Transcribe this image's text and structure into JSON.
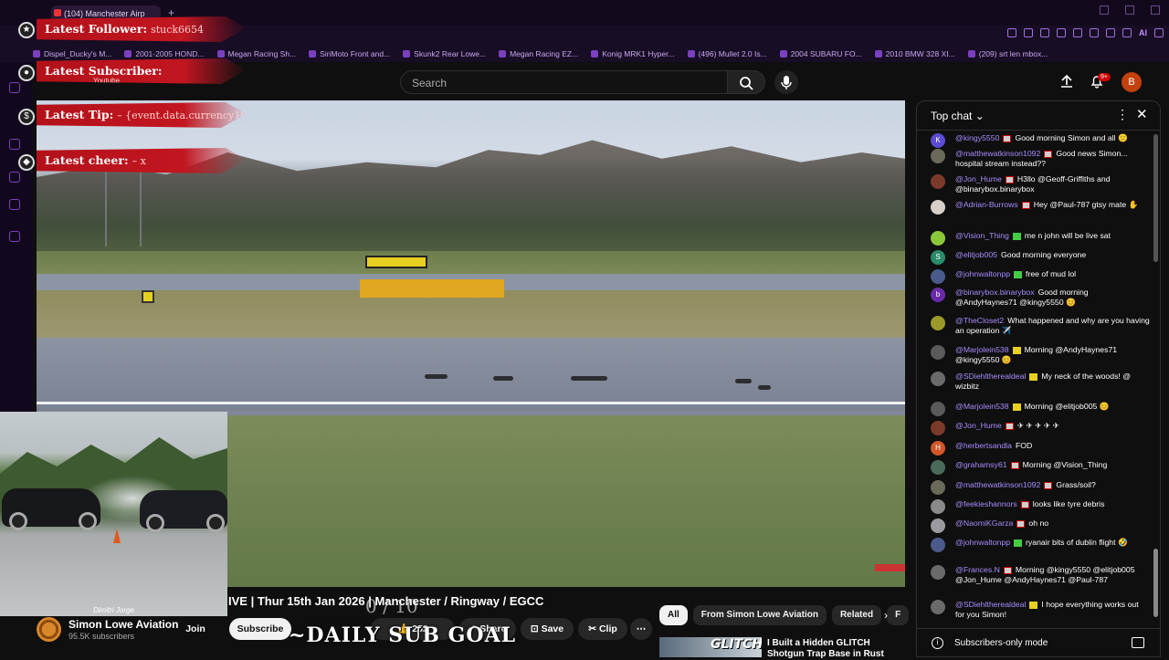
{
  "browser": {
    "tab_title": "(104) Manchester Airp",
    "new_tab": "+",
    "ai_label": "AI",
    "bookmarks": [
      "Dispel_Ducky's M...",
      "2001-2005 HOND...",
      "Megan Racing Sh...",
      "SiriMoto Front and...",
      "Skunk2 Rear Lowe...",
      "Megan Racing EZ...",
      "Konig MRK1 Hyper...",
      "(496) Mullet 2.0 Is...",
      "2004 SUBARU FO...",
      "2010 BMW 328 XI...",
      "(209) srt len mbox..."
    ]
  },
  "youtube": {
    "search_placeholder": "Search",
    "notification_count": "9+",
    "avatar_letter": "B"
  },
  "overlay": {
    "latest_follower_label": "Latest Follower:",
    "latest_follower_value": "stuck6654",
    "latest_subscriber_label": "Latest Subscriber:",
    "latest_subscriber_value": "Youtube",
    "latest_tip_label": "Latest Tip:",
    "latest_tip_value": "– {event.data.currency}0",
    "latest_cheer_label": "Latest cheer:",
    "latest_cheer_value": "– x",
    "daily_goal": "~DAILY SUB GOAL",
    "goal_count": "0 / 10",
    "webcam_caption": "Dimitri Jorge"
  },
  "video": {
    "title": "IVE | Thur 15th Jan 2026 | Manchester / Ringway / EGCC",
    "channel_name": "Simon Lowe Aviation",
    "channel_subs": "95.5K subscribers",
    "join": "Join",
    "subscribe": "Subscribe",
    "likes": "252",
    "share": "Share",
    "save": "Save",
    "clip": "Clip",
    "more": "⋯"
  },
  "related": {
    "chips": [
      "All",
      "From Simon Lowe Aviation",
      "Related",
      "F"
    ],
    "thumb_text": "GLITCH",
    "rec_title": "I Built a Hidden GLITCH Shotgun Trap Base in Rust"
  },
  "chat": {
    "title": "Top chat",
    "footer": "Subscribers-only mode",
    "messages": [
      {
        "author": "@kingy5550",
        "text": "Good morning Simon and all 🙂",
        "avatar": "K",
        "color": "#5a4bd1",
        "badge": "r"
      },
      {
        "author": "@matthewatkinson1092",
        "text": "Good news Simon... hospital stream instead??",
        "avatar": "",
        "color": "#6b6a5a",
        "badge": "r"
      },
      {
        "author": "@Jon_Hume",
        "text": "H3llo @Geoff-Griffiths and @binarybox.binarybox",
        "avatar": "",
        "color": "#7a3a2a",
        "badge": "r"
      },
      {
        "author": "@Adrian-Burrows",
        "text": "Hey @Paul-787 gtsy mate ✋",
        "avatar": "",
        "color": "#d8d0c8",
        "badge": "r"
      },
      {
        "author": "@Vision_Thing",
        "text": "me n john will be live sat",
        "avatar": "",
        "color": "#8ac83a",
        "badge": "g"
      },
      {
        "author": "@elitjob005",
        "text": "Good morning everyone",
        "avatar": "S",
        "color": "#2a8a6a",
        "badge": ""
      },
      {
        "author": "@johnwaltonpp",
        "text": "free of mud lol",
        "avatar": "",
        "color": "#4a5a8a",
        "badge": "g"
      },
      {
        "author": "@binarybox.binarybox",
        "text": "Good morning @AndyHaynes71 @kingy5550 😊",
        "avatar": "b",
        "color": "#6a2aa8",
        "badge": ""
      },
      {
        "author": "@TheCloset2",
        "text": "What happened and why are you having an operation ✈️",
        "avatar": "",
        "color": "#9a9a2a",
        "badge": ""
      },
      {
        "author": "@Marjolein538",
        "text": "Morning @AndyHaynes71 @kingy5550 😊",
        "avatar": "",
        "color": "#5a5a5a",
        "badge": "y"
      },
      {
        "author": "@SDiehltherealdeal",
        "text": "My neck of the woods! @ wizbitz",
        "avatar": "",
        "color": "#6a6a6a",
        "badge": "y"
      },
      {
        "author": "@Marjolein538",
        "text": "Morning @elitjob005 😊",
        "avatar": "",
        "color": "#5a5a5a",
        "badge": "y"
      },
      {
        "author": "@Jon_Hume",
        "text": "✈ ✈ ✈ ✈ ✈",
        "avatar": "",
        "color": "#7a3a2a",
        "badge": "r"
      },
      {
        "author": "@herbertsandla",
        "text": "FOD",
        "avatar": "H",
        "color": "#d2562a",
        "badge": ""
      },
      {
        "author": "@grahamsy61",
        "text": "Morning @Vision_Thing",
        "avatar": "",
        "color": "#4a6a5a",
        "badge": "r"
      },
      {
        "author": "@matthewatkinson1092",
        "text": "Grass/soil?",
        "avatar": "",
        "color": "#6b6a5a",
        "badge": "r"
      },
      {
        "author": "@feekieshannors",
        "text": "looks like tyre debris",
        "avatar": "",
        "color": "#8a8a8a",
        "badge": "r"
      },
      {
        "author": "@NaomiKGarza",
        "text": "oh no",
        "avatar": "",
        "color": "#9a9aa0",
        "badge": "r"
      },
      {
        "author": "@johnwaltonpp",
        "text": "ryanair bits of dublin flight 🤣",
        "avatar": "",
        "color": "#4a5a8a",
        "badge": "g"
      },
      {
        "author": "@Frances.N",
        "text": "Morning @kingy5550 @elitjob005 @Jon_Hume @AndyHaynes71 @Paul-787",
        "avatar": "",
        "color": "#6a6a6a",
        "badge": "r"
      },
      {
        "author": "@SDiehltherealdeal",
        "text": "I hope everything works out for you Simon!",
        "avatar": "",
        "color": "#6a6a6a",
        "badge": "y"
      }
    ]
  }
}
